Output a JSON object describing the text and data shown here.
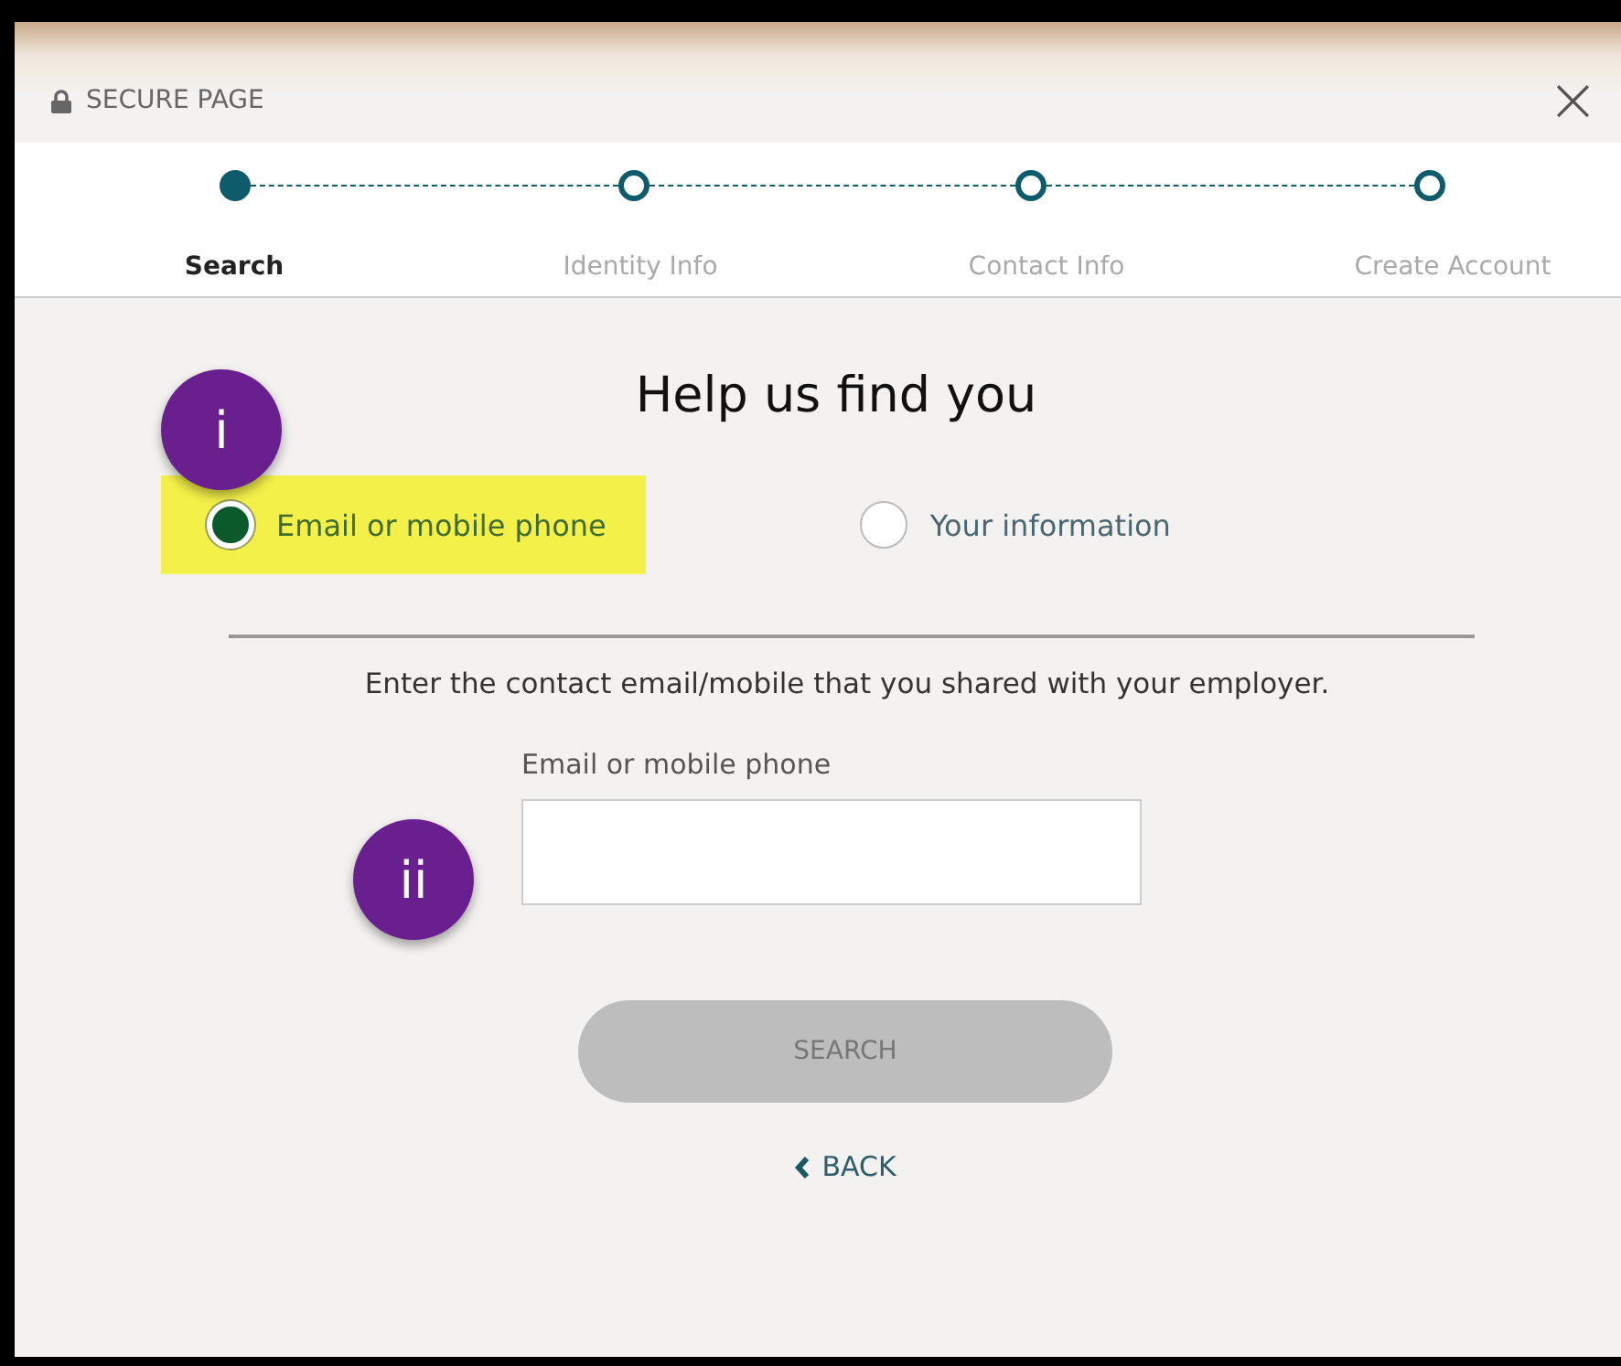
{
  "header": {
    "title": "SECURE PAGE",
    "close": "×"
  },
  "steps": [
    {
      "label": "Search",
      "selected": true
    },
    {
      "label": "Identity Info",
      "selected": false
    },
    {
      "label": "Contact Info",
      "selected": false
    },
    {
      "label": "Create Account",
      "selected": false
    }
  ],
  "heading": "Help us find you",
  "callouts": [
    {
      "label": "i"
    },
    {
      "label": "ii"
    }
  ],
  "options": [
    {
      "label": "Email or mobile phone",
      "selected": true,
      "highlighted": true
    },
    {
      "label": "Your information",
      "selected": false,
      "highlighted": false
    }
  ],
  "instruction": "Enter the contact email/mobile that you shared with your employer.",
  "field": {
    "label": "Email or mobile phone"
  },
  "search_button": {
    "label": "SEARCH",
    "disabled": true
  },
  "back_link": {
    "label": "BACK"
  }
}
